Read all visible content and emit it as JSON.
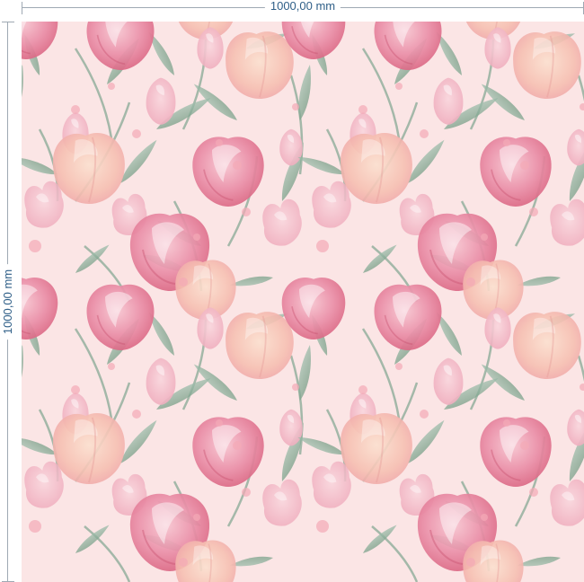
{
  "dimensions": {
    "width_label": "1000,00 mm",
    "height_label": "1000,00 mm"
  },
  "colors": {
    "background": "#fbe5e5",
    "dimension_text": "#2f5f88",
    "dimension_line": "#9fa9b3",
    "leaf": "#8fb3a1",
    "leaf_dark": "#6e9782",
    "petal_pink": "#e98aa3",
    "petal_peach": "#f7c3b1"
  },
  "pattern": {
    "motif": "watercolor pink tulip floral seamless pattern"
  }
}
